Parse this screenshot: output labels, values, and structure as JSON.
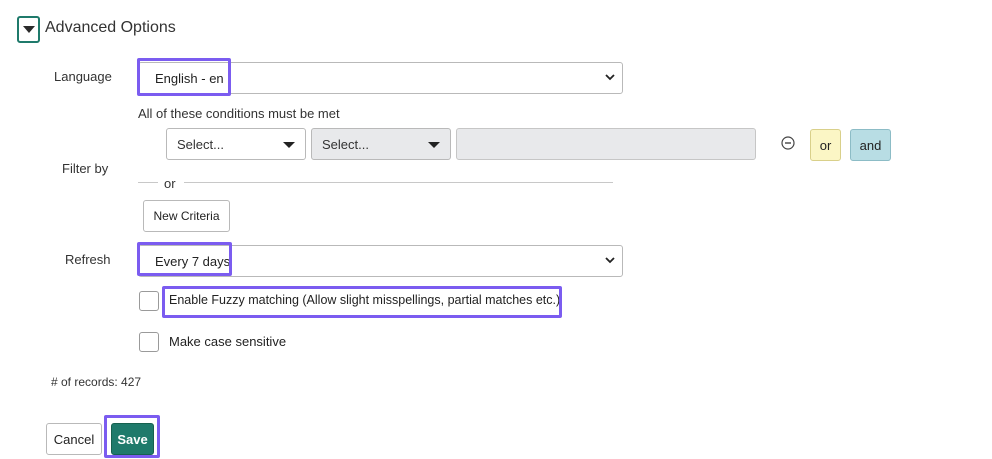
{
  "section": {
    "title": "Advanced Options",
    "toggle_icon": "triangle-down-icon"
  },
  "language": {
    "label": "Language",
    "value": "English - en"
  },
  "filter": {
    "label": "Filter by",
    "conditions_text": "All of these conditions must be met",
    "field_select": "Select...",
    "operator_select": "Select...",
    "value_input": "",
    "or_label": "or",
    "and_label": "and",
    "separator_text": "or",
    "new_criteria_label": "New Criteria"
  },
  "refresh": {
    "label": "Refresh",
    "value": "Every 7 days"
  },
  "options": {
    "fuzzy_label": "Enable Fuzzy matching (Allow slight misspellings, partial matches etc.)",
    "fuzzy_checked": false,
    "case_label": "Make case sensitive",
    "case_checked": false
  },
  "records": {
    "text": "# of records: 427"
  },
  "footer": {
    "cancel_label": "Cancel",
    "save_label": "Save"
  },
  "colors": {
    "accent": "#1f7a6b",
    "highlight": "#7b5cf0",
    "or_button": "#fbf6c5",
    "and_button": "#b8dde4",
    "disabled_field": "#e8e9eb"
  }
}
